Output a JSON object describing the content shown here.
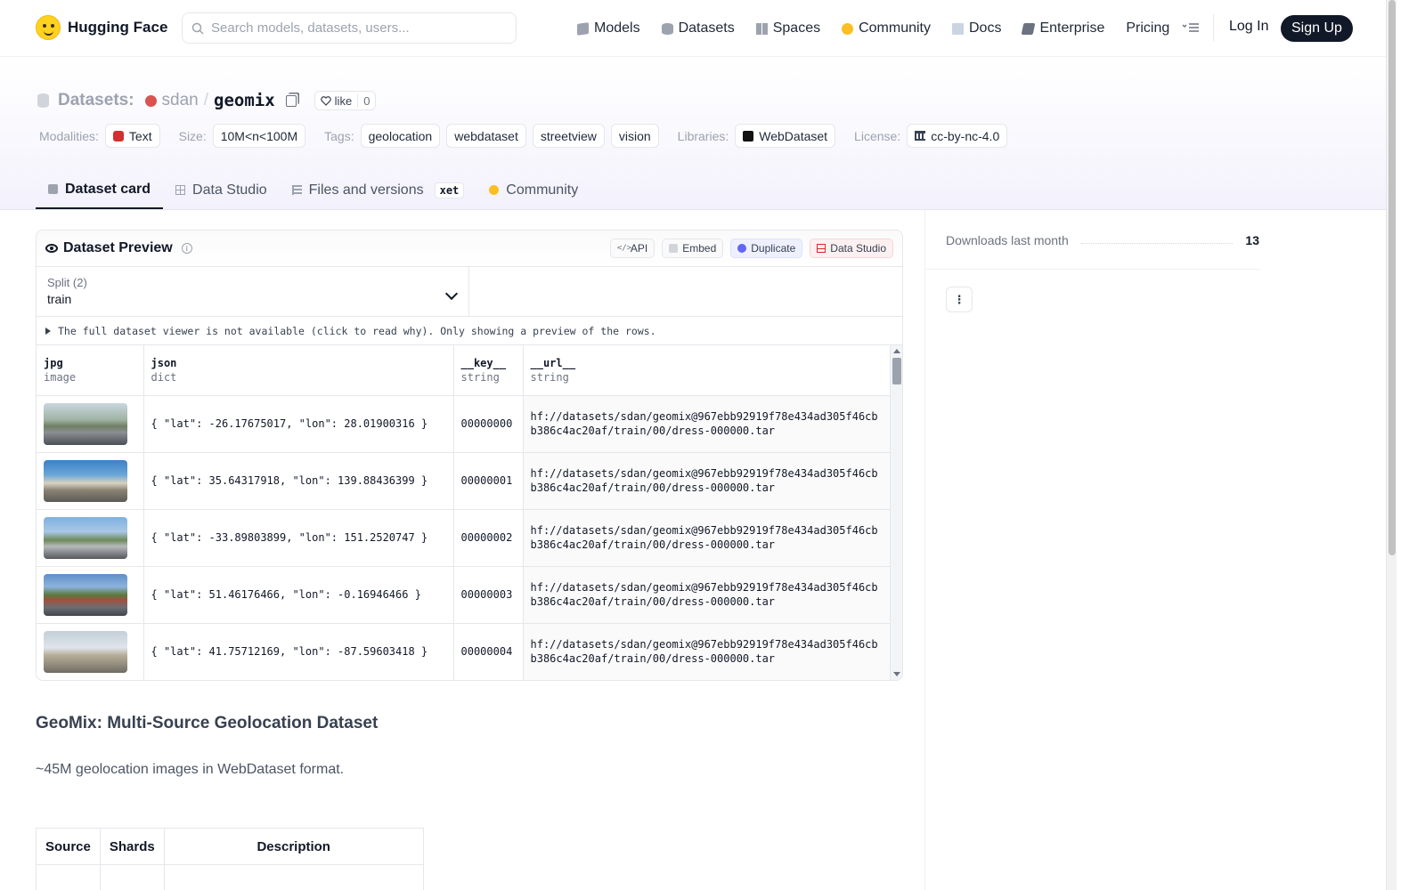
{
  "nav": {
    "brand": "Hugging Face",
    "search_placeholder": "Search models, datasets, users...",
    "links": [
      "Models",
      "Datasets",
      "Spaces",
      "Community",
      "Docs",
      "Enterprise",
      "Pricing"
    ],
    "login": "Log In",
    "signup": "Sign Up"
  },
  "header": {
    "label": "Datasets:",
    "owner": "sdan",
    "slash": "/",
    "name": "geomix",
    "like": "like",
    "like_count": "0",
    "modalities_label": "Modalities:",
    "modality": "Text",
    "size_label": "Size:",
    "size": "10M<n<100M",
    "tags_label": "Tags:",
    "tags": [
      "geolocation",
      "webdataset",
      "streetview",
      "vision"
    ],
    "libraries_label": "Libraries:",
    "library": "WebDataset",
    "license_label": "License:",
    "license": "cc-by-nc-4.0"
  },
  "tabs": {
    "card": "Dataset card",
    "studio": "Data Studio",
    "files": "Files and versions",
    "xet": "xet",
    "community": "Community"
  },
  "preview": {
    "title": "Dataset Preview",
    "btn_api": "API",
    "btn_embed": "Embed",
    "btn_duplicate": "Duplicate",
    "btn_studio": "Data Studio",
    "split_label": "Split (2)",
    "split_value": "train",
    "notice": "The full dataset viewer is not available (click to read why). Only showing a preview of the rows.",
    "columns": [
      {
        "name": "jpg",
        "type": "image"
      },
      {
        "name": "json",
        "type": "dict"
      },
      {
        "name": "__key__",
        "type": "string"
      },
      {
        "name": "__url__",
        "type": "string"
      }
    ],
    "rows": [
      {
        "json": "{ \"lat\": -26.17675017, \"lon\": 28.01900316 }",
        "key": "00000000",
        "url": "hf://datasets/sdan/geomix@967ebb92919f78e434ad305f46cbb386c4ac20af/train/00/dress-000000.tar"
      },
      {
        "json": "{ \"lat\": 35.64317918, \"lon\": 139.88436399 }",
        "key": "00000001",
        "url": "hf://datasets/sdan/geomix@967ebb92919f78e434ad305f46cbb386c4ac20af/train/00/dress-000000.tar"
      },
      {
        "json": "{ \"lat\": -33.89803899, \"lon\": 151.2520747 }",
        "key": "00000002",
        "url": "hf://datasets/sdan/geomix@967ebb92919f78e434ad305f46cbb386c4ac20af/train/00/dress-000000.tar"
      },
      {
        "json": "{ \"lat\": 51.46176466, \"lon\": -0.16946466 }",
        "key": "00000003",
        "url": "hf://datasets/sdan/geomix@967ebb92919f78e434ad305f46cbb386c4ac20af/train/00/dress-000000.tar"
      },
      {
        "json": "{ \"lat\": 41.75712169, \"lon\": -87.59603418 }",
        "key": "00000004",
        "url": "hf://datasets/sdan/geomix@967ebb92919f78e434ad305f46cbb386c4ac20af/train/00/dress-000000.tar"
      }
    ]
  },
  "card": {
    "title": "GeoMix: Multi-Source Geolocation Dataset",
    "description": "~45M geolocation images in WebDataset format.",
    "table_headers": [
      "Source",
      "Shards",
      "Description"
    ]
  },
  "sidebar": {
    "downloads_label": "Downloads last month",
    "downloads_value": "13"
  }
}
